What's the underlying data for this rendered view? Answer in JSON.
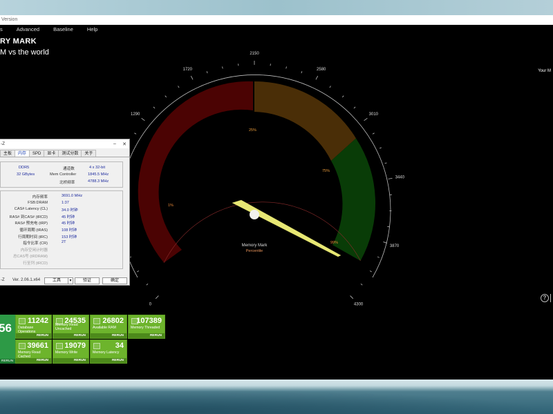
{
  "window": {
    "title_fragment": "Version",
    "menu": [
      "s",
      "Advanced",
      "Baseline",
      "Help"
    ]
  },
  "page": {
    "title": "RY MARK",
    "subtitle": "M vs the world",
    "right_label": "Your M"
  },
  "gauge": {
    "labels": [
      "0",
      "860",
      "1290",
      "1720",
      "2150",
      "2580",
      "3010",
      "3440",
      "3870",
      "4300"
    ],
    "label_values": [
      0,
      430,
      1290,
      1720,
      2150,
      2580,
      3010,
      3440,
      3870,
      4300
    ],
    "visible_label_0": "0",
    "left_partial": "60",
    "percentiles": [
      "1%",
      "25%",
      "75%",
      "99%"
    ],
    "center_title": "Memory Mark",
    "center_sub": "Percentile",
    "needle_value": 3900,
    "colors": {
      "low": "#4a0000",
      "mid": "#4a2a05",
      "high": "#0b3a08",
      "needle": "#e8e874"
    }
  },
  "tiles": [
    {
      "value": "11242",
      "label": "Database Operations",
      "rerun": "RERUN"
    },
    {
      "value": "24535",
      "label": "Memory Read\nUncached",
      "rerun": "RERUN"
    },
    {
      "value": "26802",
      "label": "Available RAM",
      "rerun": "RERUN"
    },
    {
      "value": "107389",
      "label": "Memory Threaded",
      "rerun": "RERUN"
    },
    {
      "value": "39661",
      "label": "Memory Read Cached",
      "rerun": "RERUN"
    },
    {
      "value": "19079",
      "label": "Memory Write",
      "rerun": "RERUN"
    },
    {
      "value": "34",
      "label": "Memory Latency",
      "rerun": "RERUN"
    }
  ],
  "score": {
    "value": "56",
    "rerun": "RERUN"
  },
  "cpuz": {
    "title": "-Z",
    "tabs": [
      "主板",
      "内存",
      "SPD",
      "显卡",
      "测试分数",
      "关于"
    ],
    "active_tab": "内存",
    "type_value": "DDR5",
    "size_value": "32 GBytes",
    "channel_label": "通道数",
    "channel_value": "4 x 32-bit",
    "memctrl_label": "Mem Controller",
    "memctrl_value": "1845.5 MHz",
    "nb_label": "北桥频率",
    "nb_value": "4788.3 MHz",
    "timings": [
      {
        "label": "内存频率",
        "value": "3691.0 MHz"
      },
      {
        "label": "FSB:DRAM",
        "value": "1:37"
      },
      {
        "label": "CAS# Latency (CL)",
        "value": "34.0 时钟"
      },
      {
        "label": "RAS# 到CAS# (tRCD)",
        "value": "45 时钟"
      },
      {
        "label": "RAS# 预充电 (tRP)",
        "value": "45 时钟"
      },
      {
        "label": "循环周期 (tRAS)",
        "value": "108 时钟"
      },
      {
        "label": "行周期时间 (tRC)",
        "value": "153 时钟"
      },
      {
        "label": "指令比率 (CR)",
        "value": "2T"
      }
    ],
    "dim_labels": [
      "内存空闲计时器",
      "总CAS号 (tRDRAM)",
      "行至列 (tRCD)"
    ],
    "version": "Ver. 2.06.1.x64",
    "tools_label": "工具",
    "validate_label": "验证",
    "ok_label": "确定"
  }
}
